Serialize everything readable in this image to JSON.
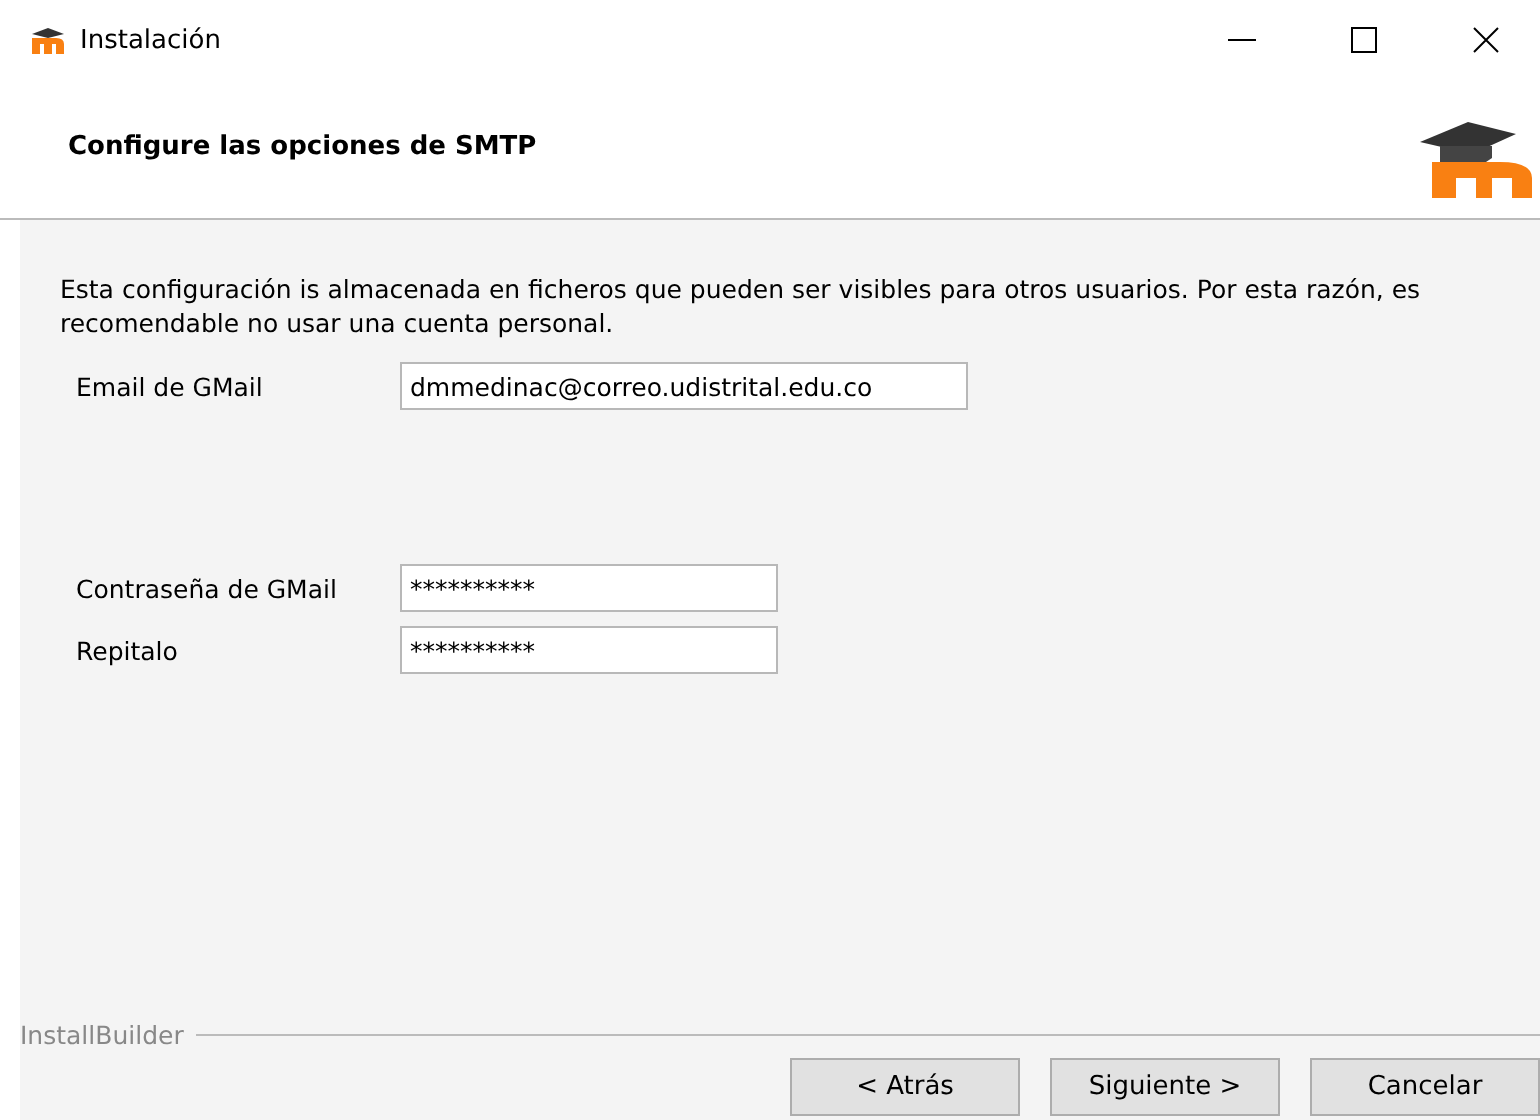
{
  "window": {
    "title": "Instalación"
  },
  "header": {
    "title": "Configure las opciones de SMTP"
  },
  "description": "Esta configuración is almacenada en ficheros que pueden ser visibles para otros usuarios. Por esta razón, es recomendable no usar una cuenta personal.",
  "email": {
    "label": "Email de GMail",
    "value": "dmmedinac@correo.udistrital.edu.co"
  },
  "passwords": [
    {
      "label": "Contraseña de GMail",
      "value": "**********"
    },
    {
      "label": "Repitalo",
      "value": "**********"
    }
  ],
  "footer": {
    "brand": "InstallBuilder"
  },
  "buttons": [
    "< Atrás",
    "Siguiente >",
    "Cancelar"
  ]
}
